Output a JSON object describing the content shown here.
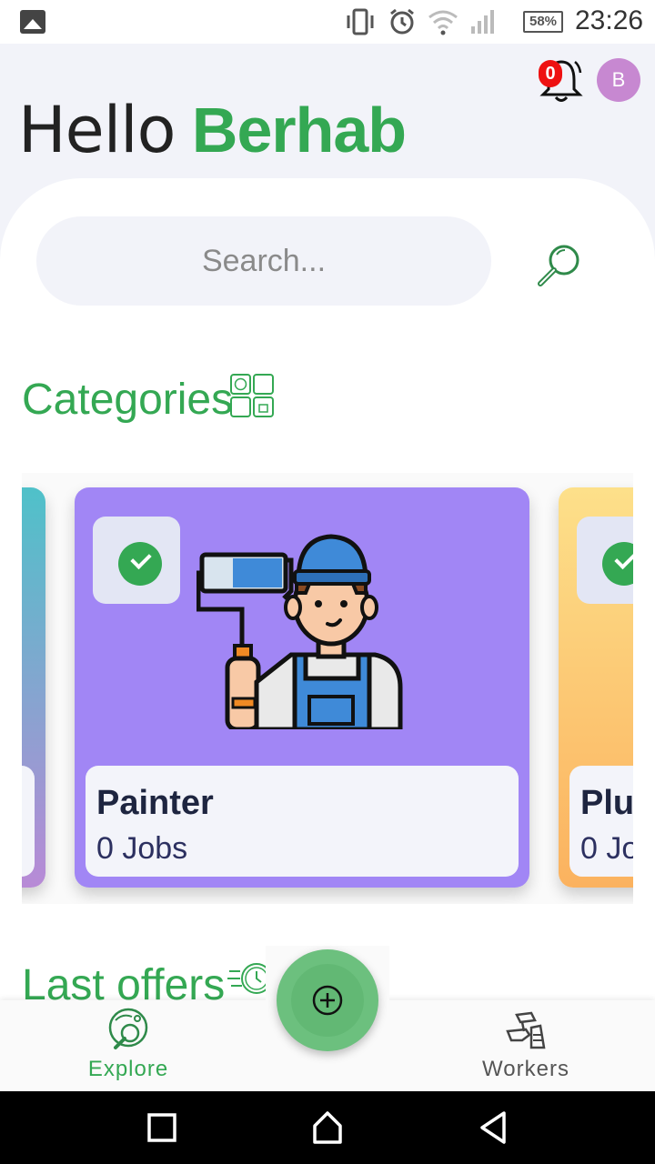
{
  "status_bar": {
    "battery": "58%",
    "time": "23:26"
  },
  "header": {
    "greeting": "Hello",
    "user_name": "Berhab",
    "notification_count": "0",
    "avatar_initial": "B"
  },
  "search": {
    "placeholder": "Search..."
  },
  "categories": {
    "title": "Categories",
    "items": [
      {
        "name": "Painter",
        "jobs": "0 Jobs"
      },
      {
        "name": "Plu",
        "jobs": "0 Jo"
      }
    ]
  },
  "last_offers": {
    "title": "Last offers"
  },
  "bottom_nav": {
    "explore_label": "Explore",
    "workers_label": "Workers"
  },
  "colors": {
    "accent": "#34a853",
    "painter_card": "#a186f5",
    "fab": "#6cc07e",
    "badge": "#ee1111",
    "avatar": "#c788d1"
  }
}
